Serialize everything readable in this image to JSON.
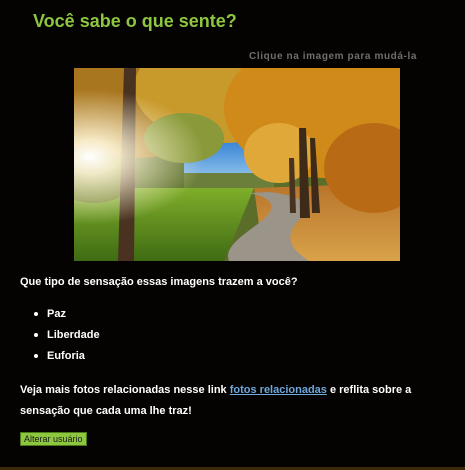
{
  "header": {
    "title": "Você sabe o que sente?"
  },
  "image": {
    "hint": "Clique na imagem para mudá-la"
  },
  "question": "Que tipo de sensação essas imagens trazem a você?",
  "feelings": [
    "Paz",
    "Liberdade",
    "Euforia"
  ],
  "paragraph": {
    "before_link": "Veja mais fotos relacionadas nesse link ",
    "link_text": "fotos relacionadas",
    "after_link": " e reflita sobre a sensação que cada uma lhe traz!"
  },
  "footer": {
    "button_label": "Alterar usuário"
  },
  "colors": {
    "background": "#050302",
    "title": "#8dc63f",
    "link": "#6fa8dc",
    "button": "#8dc63f"
  }
}
